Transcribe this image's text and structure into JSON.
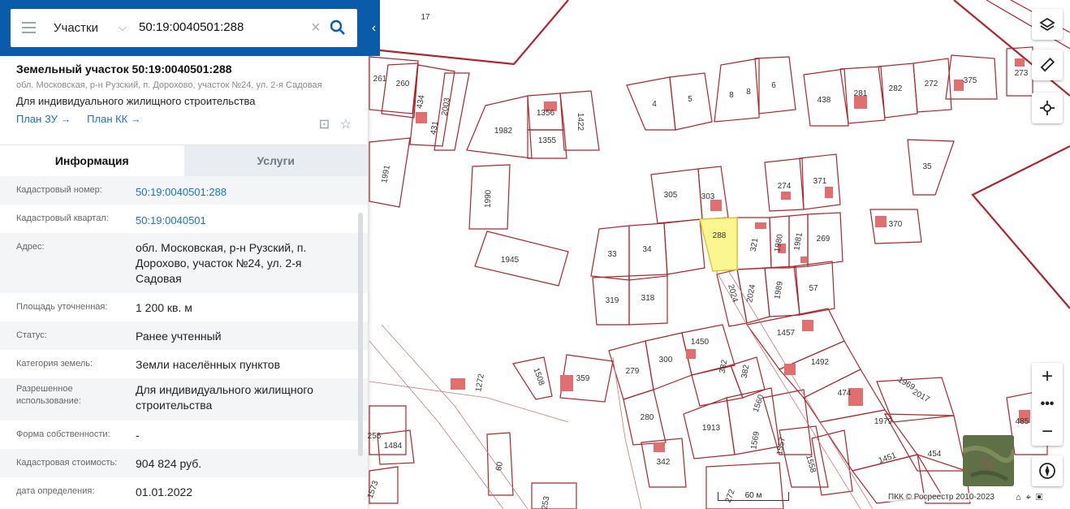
{
  "search": {
    "category": "Участки",
    "query": "50:19:0040501:288"
  },
  "parcel": {
    "title": "Земельный участок 50:19:0040501:288",
    "address_short": "обл. Московская, р-н Рузский, п. Дорохово, участок №24, ул. 2-я Садовая",
    "purpose": "Для индивидуального жилищного строительства",
    "link_plan_zu": "План ЗУ →",
    "link_plan_kk": "План КК →"
  },
  "tabs": {
    "info": "Информация",
    "services": "Услуги"
  },
  "fields": [
    {
      "label": "Кадастровый номер:",
      "value": "50:19:0040501:288"
    },
    {
      "label": "Кадастровый квартал:",
      "value": "50:19:0040501"
    },
    {
      "label": "Адрес:",
      "value": "обл. Московская, р-н Рузский, п. Дорохово, участок №24, ул. 2-я Садовая"
    },
    {
      "label": "Площадь уточненная:",
      "value": "1 200 кв. м"
    },
    {
      "label": "Статус:",
      "value": "Ранее учтенный"
    },
    {
      "label": "Категория земель:",
      "value": "Земли населённых пунктов"
    },
    {
      "label": "Разрешенное использование:",
      "value": "Для индивидуального жилищного строительства"
    },
    {
      "label": "Форма собственности:",
      "value": "-"
    },
    {
      "label": "Кадастровая стоимость:",
      "value": "904 824 руб."
    },
    {
      "label": "дата определения:",
      "value": "01.01.2022"
    }
  ],
  "map": {
    "selected": "288",
    "labels": [
      "17",
      "261",
      "260",
      "434",
      "2003",
      "431",
      "1356",
      "1422",
      "1982",
      "1355",
      "4",
      "5",
      "8",
      "8",
      "6",
      "438",
      "281",
      "282",
      "272",
      "375",
      "273",
      "1991",
      "1990",
      "305",
      "303",
      "274",
      "371",
      "35",
      "1945",
      "33",
      "34",
      "288",
      "321",
      "1980",
      "1981",
      "269",
      "370",
      "319",
      "318",
      "2024",
      "1989",
      "57",
      "1457",
      "1450",
      "300",
      "279",
      "382",
      "382",
      "1492",
      "1508",
      "359",
      "1272",
      "1969",
      "2017",
      "474",
      "1979",
      "280",
      "1913",
      "1560",
      "1569",
      "1557",
      "1558",
      "342",
      "1451",
      "454",
      "485",
      "255",
      "1484",
      "60",
      "1573",
      "253",
      "272"
    ],
    "scale": "60 м",
    "attribution": "ПКК © Росреестр 2010-2023"
  },
  "colors": {
    "header": "#0a5ba9",
    "link": "#1a73c7",
    "parcel_line": "#b0252b",
    "selected_fill": "#fbf68f"
  }
}
